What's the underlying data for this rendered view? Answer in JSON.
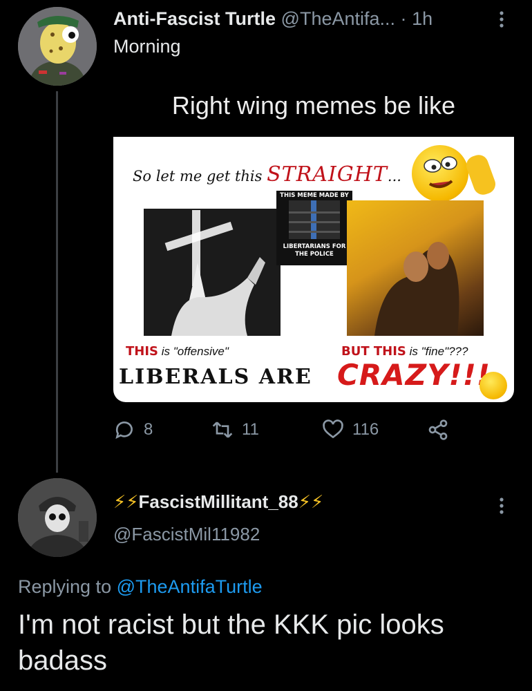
{
  "tweet1": {
    "display_name": "Anti-Fascist Turtle",
    "handle": "@TheAntifa...",
    "separator": "·",
    "time": "1h",
    "text": "Morning",
    "avatar_icon": "turtle-avatar",
    "media": {
      "caption": "Right wing memes be like",
      "meme_lead": "So let me get this",
      "meme_straight": "STRAIGHT",
      "meme_ellipsis": "...",
      "logo_top": "THIS MEME MADE BY",
      "logo_bottom_1": "LIBERTARIANS FOR",
      "logo_bottom_2": "THE POLICE",
      "left_this": "THIS",
      "left_rest": "is \"offensive\"",
      "right_but": "BUT THIS",
      "right_rest": "is \"fine\"???",
      "liberals_are": "LIBERALS ARE",
      "crazy": "CRAZY!!!"
    },
    "actions": {
      "replies": "8",
      "retweets": "11",
      "likes": "116"
    }
  },
  "tweet2": {
    "display_name_core": "FascistMillitant_88",
    "bolts_left": "⚡⚡",
    "bolts_right": "⚡⚡",
    "handle": "@FascistMil11982",
    "replying_prefix": "Replying to",
    "replying_mention": "@TheAntifaTurtle",
    "text": "I'm not racist but the KKK pic looks badass",
    "avatar_icon": "skull-soldier-avatar"
  },
  "colors": {
    "background": "#000000",
    "muted": "#8b98a5",
    "link": "#1d9bf0",
    "bolt": "#f7c325",
    "meme_red": "#c0121a"
  }
}
